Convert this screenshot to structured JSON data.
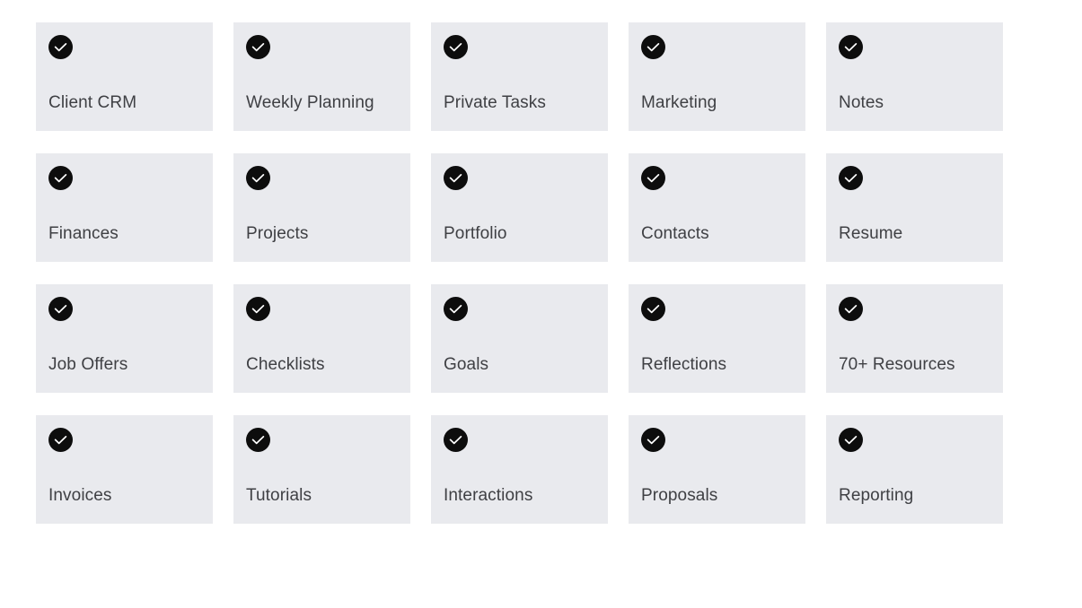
{
  "grid": {
    "columns": 5,
    "rows": 4,
    "card_background": "#e9eaee",
    "label_color": "#3f4044",
    "icon": {
      "name": "check-circle-icon",
      "circle_color": "#0d0d0d",
      "check_color": "#ffffff"
    },
    "cards": [
      {
        "label": "Client CRM",
        "icon": "check-circle-icon",
        "checked": true
      },
      {
        "label": "Weekly Planning",
        "icon": "check-circle-icon",
        "checked": true
      },
      {
        "label": "Private Tasks",
        "icon": "check-circle-icon",
        "checked": true
      },
      {
        "label": "Marketing",
        "icon": "check-circle-icon",
        "checked": true
      },
      {
        "label": "Notes",
        "icon": "check-circle-icon",
        "checked": true
      },
      {
        "label": "Finances",
        "icon": "check-circle-icon",
        "checked": true
      },
      {
        "label": "Projects",
        "icon": "check-circle-icon",
        "checked": true
      },
      {
        "label": "Portfolio",
        "icon": "check-circle-icon",
        "checked": true
      },
      {
        "label": "Contacts",
        "icon": "check-circle-icon",
        "checked": true
      },
      {
        "label": "Resume",
        "icon": "check-circle-icon",
        "checked": true
      },
      {
        "label": "Job Offers",
        "icon": "check-circle-icon",
        "checked": true
      },
      {
        "label": "Checklists",
        "icon": "check-circle-icon",
        "checked": true
      },
      {
        "label": "Goals",
        "icon": "check-circle-icon",
        "checked": true
      },
      {
        "label": "Reflections",
        "icon": "check-circle-icon",
        "checked": true
      },
      {
        "label": "70+ Resources",
        "icon": "check-circle-icon",
        "checked": true
      },
      {
        "label": "Invoices",
        "icon": "check-circle-icon",
        "checked": true
      },
      {
        "label": "Tutorials",
        "icon": "check-circle-icon",
        "checked": true
      },
      {
        "label": "Interactions",
        "icon": "check-circle-icon",
        "checked": true
      },
      {
        "label": "Proposals",
        "icon": "check-circle-icon",
        "checked": true
      },
      {
        "label": "Reporting",
        "icon": "check-circle-icon",
        "checked": true
      }
    ]
  }
}
